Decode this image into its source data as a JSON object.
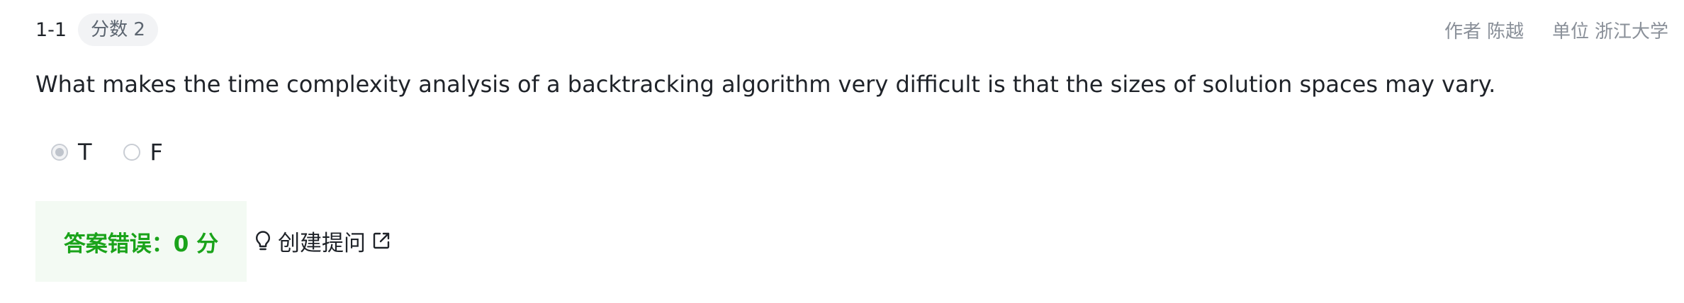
{
  "header": {
    "question_number": "1-1",
    "score_badge": "分数 2",
    "author_label": "作者",
    "author_name": "陈越",
    "unit_label": "单位",
    "unit_name": "浙江大学"
  },
  "question": {
    "text": "What makes the time complexity analysis of a backtracking algorithm very difficult is that the sizes of solution spaces may vary."
  },
  "options": [
    {
      "label": "T",
      "selected": true
    },
    {
      "label": "F",
      "selected": false
    }
  ],
  "result": {
    "text": "答案错误：0 分",
    "color": "#1aa31a",
    "background": "#f3faf3"
  },
  "ask": {
    "label": "创建提问",
    "icon": "lightbulb-icon",
    "link_icon": "external-link-icon"
  }
}
